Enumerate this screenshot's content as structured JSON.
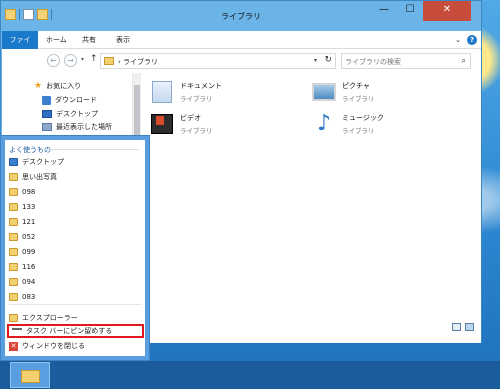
{
  "window": {
    "title": "ライブラリ",
    "buttons": {
      "minimize": "—",
      "maximize": "☐",
      "close": "✕"
    }
  },
  "ribbon": {
    "tabs": [
      "ファイル",
      "ホーム",
      "共有",
      "表示"
    ],
    "expand_glyph": "⌄",
    "help_glyph": "?"
  },
  "navbar": {
    "back_glyph": "←",
    "forward_glyph": "→",
    "dropdown_glyph": "▾",
    "up_glyph": "↑",
    "address_text": "› ライブラリ",
    "refresh_glyph": "↻",
    "search_placeholder": "ライブラリの検索",
    "search_glyph": "⌕"
  },
  "navpane": {
    "items": [
      {
        "label": "お気に入り",
        "icon": "star-icon",
        "glyph": "★"
      },
      {
        "label": "ダウンロード",
        "icon": "download-icon"
      },
      {
        "label": "デスクトップ",
        "icon": "desktop-icon"
      },
      {
        "label": "最近表示した場所",
        "icon": "recent-places-icon"
      }
    ]
  },
  "libraries": [
    {
      "name": "ドキュメント",
      "sub": "ライブラリ",
      "icon": "documents-icon"
    },
    {
      "name": "ピクチャ",
      "sub": "ライブラリ",
      "icon": "pictures-icon"
    },
    {
      "name": "ビデオ",
      "sub": "ライブラリ",
      "icon": "videos-icon"
    },
    {
      "name": "ミュージック",
      "sub": "ライブラリ",
      "icon": "music-icon",
      "glyph": "♪"
    }
  ],
  "jumplist": {
    "heading": "よく使うもの",
    "frequent": [
      "デスクトップ",
      "思い出写真",
      "098",
      "133",
      "121",
      "052",
      "099",
      "116",
      "094",
      "083"
    ],
    "tasks": [
      {
        "label": "エクスプローラー",
        "icon": "folder-icon"
      },
      {
        "label": "タスク バーにピン留めする",
        "icon": "pin-icon"
      },
      {
        "label": "ウィンドウを閉じる",
        "icon": "close-window-icon",
        "glyph": "✕"
      }
    ],
    "highlight_color": "#e0191f"
  }
}
